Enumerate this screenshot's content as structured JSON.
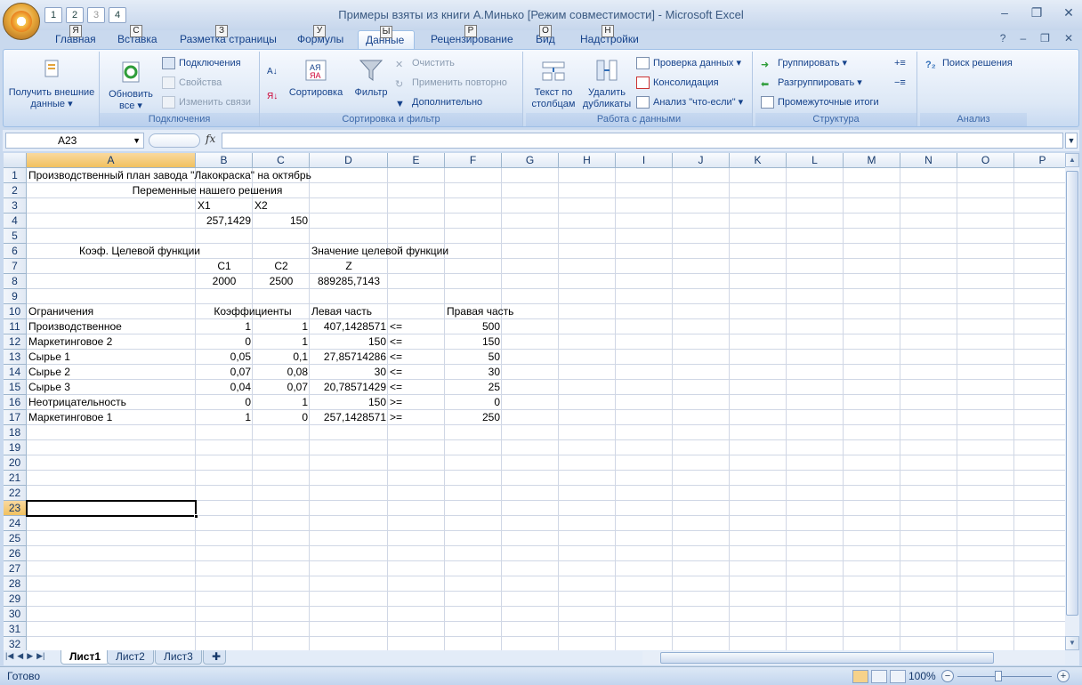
{
  "window": {
    "title": "Примеры взяты из книги А.Минько  [Режим совместимости] - Microsoft Excel"
  },
  "qat": {
    "keytips": [
      "1",
      "2",
      "3",
      "4"
    ]
  },
  "tabs": [
    {
      "label": "Главная",
      "keytip": "Я"
    },
    {
      "label": "Вставка",
      "keytip": "С"
    },
    {
      "label": "Разметка страницы",
      "keytip": "З"
    },
    {
      "label": "Формулы",
      "keytip": "У"
    },
    {
      "label": "Данные",
      "keytip": "Ы"
    },
    {
      "label": "Рецензирование",
      "keytip": "Р"
    },
    {
      "label": "Вид",
      "keytip": "О"
    },
    {
      "label": "Надстройки",
      "keytip": "Н"
    }
  ],
  "ribbon": {
    "external": {
      "label": "Получить внешние данные"
    },
    "connections": {
      "group": "Подключения",
      "refresh": "Обновить все",
      "connections": "Подключения",
      "properties": "Свойства",
      "edit_links": "Изменить связи"
    },
    "sortfilter": {
      "group": "Сортировка и фильтр",
      "sort": "Сортировка",
      "filter": "Фильтр",
      "clear": "Очистить",
      "reapply": "Применить повторно",
      "advanced": "Дополнительно"
    },
    "datatools": {
      "group": "Работа с данными",
      "text_to_cols": "Текст по столбцам",
      "remove_dup": "Удалить дубликаты",
      "validation": "Проверка данных",
      "consolidate": "Консолидация",
      "whatif": "Анализ \"что-если\""
    },
    "outline": {
      "group": "Структура",
      "group_btn": "Группировать",
      "ungroup": "Разгруппировать",
      "subtotal": "Промежуточные итоги"
    },
    "analysis": {
      "group": "Анализ",
      "solver": "Поиск решения"
    }
  },
  "formula_bar": {
    "name_box": "A23",
    "fx": "fx",
    "value": ""
  },
  "columns": [
    "A",
    "B",
    "C",
    "D",
    "E",
    "F",
    "G",
    "H",
    "I",
    "J",
    "K",
    "L",
    "M",
    "N",
    "O",
    "P"
  ],
  "rows": [
    "1",
    "2",
    "3",
    "4",
    "5",
    "6",
    "7",
    "8",
    "9",
    "10",
    "11",
    "12",
    "13",
    "14",
    "15",
    "16",
    "17",
    "18",
    "19",
    "20",
    "21",
    "22",
    "23",
    "24",
    "25",
    "26",
    "27",
    "28",
    "29",
    "30",
    "31",
    "32"
  ],
  "cells": {
    "r1": {
      "title": "Производственный план завода \"Лакокраска\" на октябрь"
    },
    "r2": {
      "title": "Переменные нашего решения"
    },
    "r3": {
      "b": "X1",
      "c": "X2"
    },
    "r4": {
      "b": "257,1429",
      "c": "150"
    },
    "r6": {
      "a": "Коэф. Целевой функции",
      "d": "Значение целевой функции"
    },
    "r7": {
      "b": "C1",
      "c": "C2",
      "d": "Z"
    },
    "r8": {
      "b": "2000",
      "c": "2500",
      "d": "889285,7143"
    },
    "r10": {
      "a": "Ограничения",
      "b": "Коэффициенты",
      "d": "Левая часть",
      "f": "Правая часть"
    },
    "r11": {
      "a": "Производственное",
      "b": "1",
      "c": "1",
      "d": "407,1428571",
      "e": "<=",
      "f": "500"
    },
    "r12": {
      "a": "Маркетинговое 2",
      "b": "0",
      "c": "1",
      "d": "150",
      "e": "<=",
      "f": "150"
    },
    "r13": {
      "a": "Сырье 1",
      "b": "0,05",
      "c": "0,1",
      "d": "27,85714286",
      "e": "<=",
      "f": "50"
    },
    "r14": {
      "a": "Сырье 2",
      "b": "0,07",
      "c": "0,08",
      "d": "30",
      "e": "<=",
      "f": "30"
    },
    "r15": {
      "a": "Сырье 3",
      "b": "0,04",
      "c": "0,07",
      "d": "20,78571429",
      "e": "<=",
      "f": "25"
    },
    "r16": {
      "a": "Неотрицательность",
      "b": "0",
      "c": "1",
      "d": "150",
      "e": ">=",
      "f": "0"
    },
    "r17": {
      "a": "Маркетинговое 1",
      "b": "1",
      "c": "0",
      "d": "257,1428571",
      "e": ">=",
      "f": "250"
    }
  },
  "sheets": [
    "Лист1",
    "Лист2",
    "Лист3"
  ],
  "status": {
    "text": "Готово",
    "zoom": "100%"
  }
}
